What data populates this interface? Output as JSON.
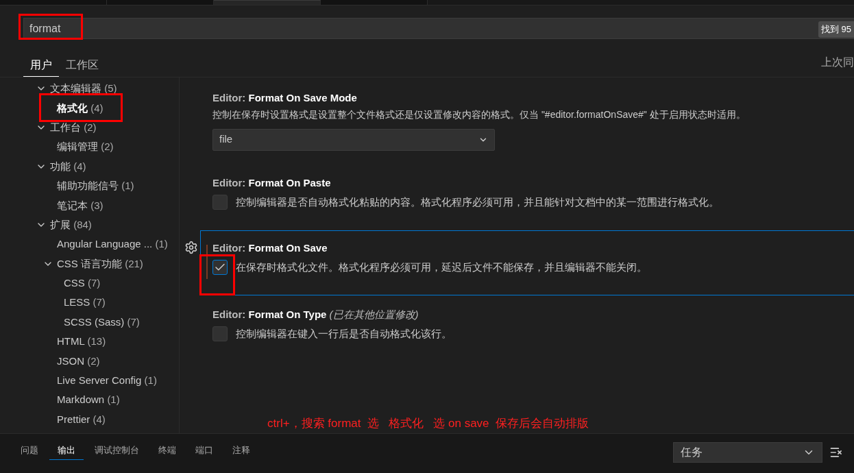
{
  "editor_tabs": [
    {
      "selected": false
    },
    {
      "selected": false
    },
    {
      "selected": true
    },
    {
      "selected": false
    }
  ],
  "search": {
    "value": "format",
    "result_count": "找到 95",
    "highlighted": true
  },
  "scope_tabs": [
    {
      "label": "用户",
      "selected": true
    },
    {
      "label": "工作区",
      "selected": false
    }
  ],
  "last_sync": "上次同",
  "tree": [
    {
      "label": "文本编辑器",
      "count": "(5)",
      "selected": false,
      "highlighted": false,
      "expanded": true,
      "children": [
        {
          "label": "格式化",
          "count": "(4)",
          "selected": true,
          "highlighted": true
        }
      ]
    },
    {
      "label": "工作台",
      "count": "(2)",
      "selected": false,
      "highlighted": false,
      "expanded": true,
      "children": [
        {
          "label": "编辑管理",
          "count": "(2)",
          "selected": false,
          "highlighted": false
        }
      ]
    },
    {
      "label": "功能",
      "count": "(4)",
      "selected": false,
      "highlighted": false,
      "expanded": true,
      "children": [
        {
          "label": "辅助功能信号",
          "count": "(1)",
          "selected": false,
          "highlighted": false
        },
        {
          "label": "笔记本",
          "count": "(3)",
          "selected": false,
          "highlighted": false
        }
      ]
    },
    {
      "label": "扩展",
      "count": "(84)",
      "selected": false,
      "highlighted": false,
      "expanded": true,
      "children": [
        {
          "label": "Angular Language ...",
          "count": "(1)",
          "selected": false,
          "highlighted": false
        },
        {
          "label": "CSS 语言功能",
          "count": "(21)",
          "selected": false,
          "highlighted": false,
          "expanded": true,
          "children": [
            {
              "label": "CSS",
              "count": "(7)",
              "selected": false,
              "highlighted": false
            },
            {
              "label": "LESS",
              "count": "(7)",
              "selected": false,
              "highlighted": false
            },
            {
              "label": "SCSS (Sass)",
              "count": "(7)",
              "selected": false,
              "highlighted": false
            }
          ]
        },
        {
          "label": "HTML",
          "count": "(13)",
          "selected": false,
          "highlighted": false
        },
        {
          "label": "JSON",
          "count": "(2)",
          "selected": false,
          "highlighted": false
        },
        {
          "label": "Live Server Config",
          "count": "(1)",
          "selected": false,
          "highlighted": false
        },
        {
          "label": "Markdown",
          "count": "(1)",
          "selected": false,
          "highlighted": false
        },
        {
          "label": "Prettier",
          "count": "(4)",
          "selected": false,
          "highlighted": false
        }
      ]
    }
  ],
  "settings": [
    {
      "kind": "dropdown",
      "category": "Editor:",
      "name": "Format On Save Mode",
      "description": "控制在保存时设置格式是设置整个文件格式还是仅设置修改内容的格式。仅当 \"#editor.formatOnSave#\" 处于启用状态时适用。",
      "value": "file",
      "focused": false,
      "modified": false,
      "highlighted": false
    },
    {
      "kind": "checkbox",
      "category": "Editor:",
      "name": "Format On Paste",
      "description": "控制编辑器是否自动格式化粘贴的内容。格式化程序必须可用，并且能针对文档中的某一范围进行格式化。",
      "checked": false,
      "focused": false,
      "modified": false,
      "highlighted": false
    },
    {
      "kind": "checkbox",
      "category": "Editor:",
      "name": "Format On Save",
      "description": "在保存时格式化文件。格式化程序必须可用，延迟后文件不能保存，并且编辑器不能关闭。",
      "checked": true,
      "focused": true,
      "modified": true,
      "highlighted": true
    },
    {
      "kind": "checkbox",
      "category": "Editor:",
      "name": "Format On Type",
      "note": "(已在其他位置修改)",
      "description": "控制编辑器在键入一行后是否自动格式化该行。",
      "checked": false,
      "focused": false,
      "modified": false,
      "highlighted": false
    }
  ],
  "annotation": "ctrl+，搜索 format  选   格式化   选 on save  保存后会自动排版",
  "panel": {
    "tabs": [
      {
        "label": "问题",
        "selected": false
      },
      {
        "label": "输出",
        "selected": true
      },
      {
        "label": "调试控制台",
        "selected": false
      },
      {
        "label": "终端",
        "selected": false
      },
      {
        "label": "端口",
        "selected": false
      },
      {
        "label": "注释",
        "selected": false
      }
    ],
    "channel": "任务"
  }
}
